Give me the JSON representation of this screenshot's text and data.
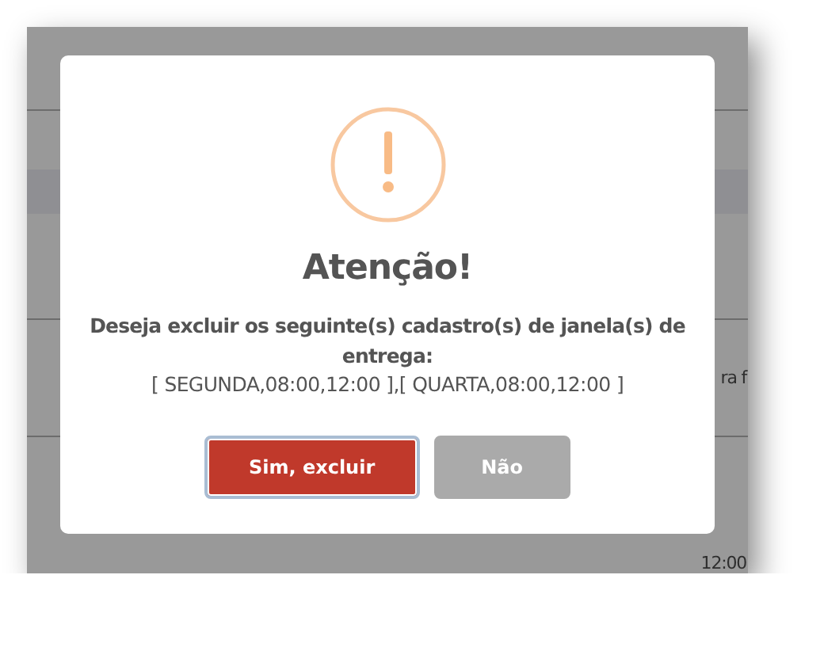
{
  "background": {
    "rows": [
      {
        "text": ""
      },
      {
        "text": ""
      },
      {
        "text": ""
      },
      {
        "text": ""
      },
      {
        "text": "ra f"
      },
      {
        "text": "12:00"
      }
    ]
  },
  "dialog": {
    "title": "Atenção!",
    "message": "Deseja excluir os seguinte(s) cadastro(s) de janela(s) de entrega:",
    "items": "[ SEGUNDA,08:00,12:00 ],[ QUARTA,08:00,12:00 ]",
    "buttons": [
      {
        "label": "Sim, excluir",
        "kind": "confirm",
        "focused": true
      },
      {
        "label": "Não",
        "kind": "cancel",
        "focused": false
      }
    ]
  }
}
